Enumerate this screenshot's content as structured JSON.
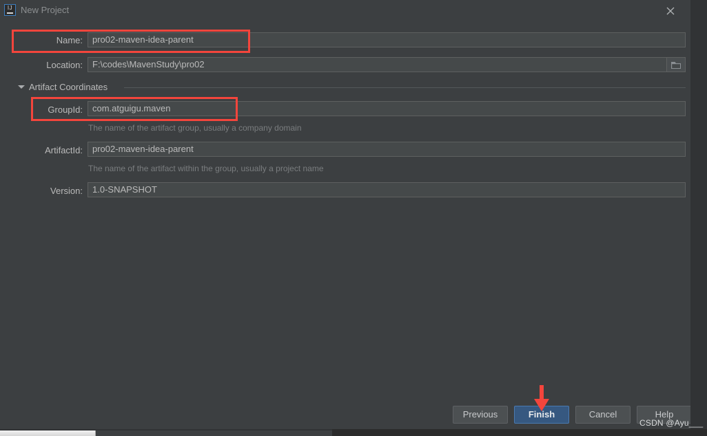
{
  "window": {
    "title": "New Project",
    "app_icon": "intellij-idea-icon",
    "close_icon": "close-icon"
  },
  "form": {
    "name": {
      "label": "Name:",
      "value": "pro02-maven-idea-parent"
    },
    "location": {
      "label": "Location:",
      "value": "F:\\codes\\MavenStudy\\pro02",
      "browse_icon": "folder-icon"
    },
    "section": {
      "label": "Artifact Coordinates",
      "expanded": true,
      "toggle_icon": "chevron-down-icon"
    },
    "group_id": {
      "label": "GroupId:",
      "value": "com.atguigu.maven",
      "hint": "The name of the artifact group, usually a company domain"
    },
    "artifact_id": {
      "label": "ArtifactId:",
      "value": "pro02-maven-idea-parent",
      "hint": "The name of the artifact within the group, usually a project name"
    },
    "version": {
      "label": "Version:",
      "value": "1.0-SNAPSHOT"
    }
  },
  "buttons": {
    "previous": "Previous",
    "finish": "Finish",
    "cancel": "Cancel",
    "help": "Help"
  },
  "annotations": {
    "watermark": "CSDN @Ayu___",
    "highlight_color": "#f4453c",
    "arrow_color": "#f4453c"
  },
  "colors": {
    "dialog_background": "#3c3f41",
    "field_background": "#45494a",
    "primary_button": "#365880",
    "text": "#bbbbbb",
    "hint_text": "#7a7d7f"
  }
}
